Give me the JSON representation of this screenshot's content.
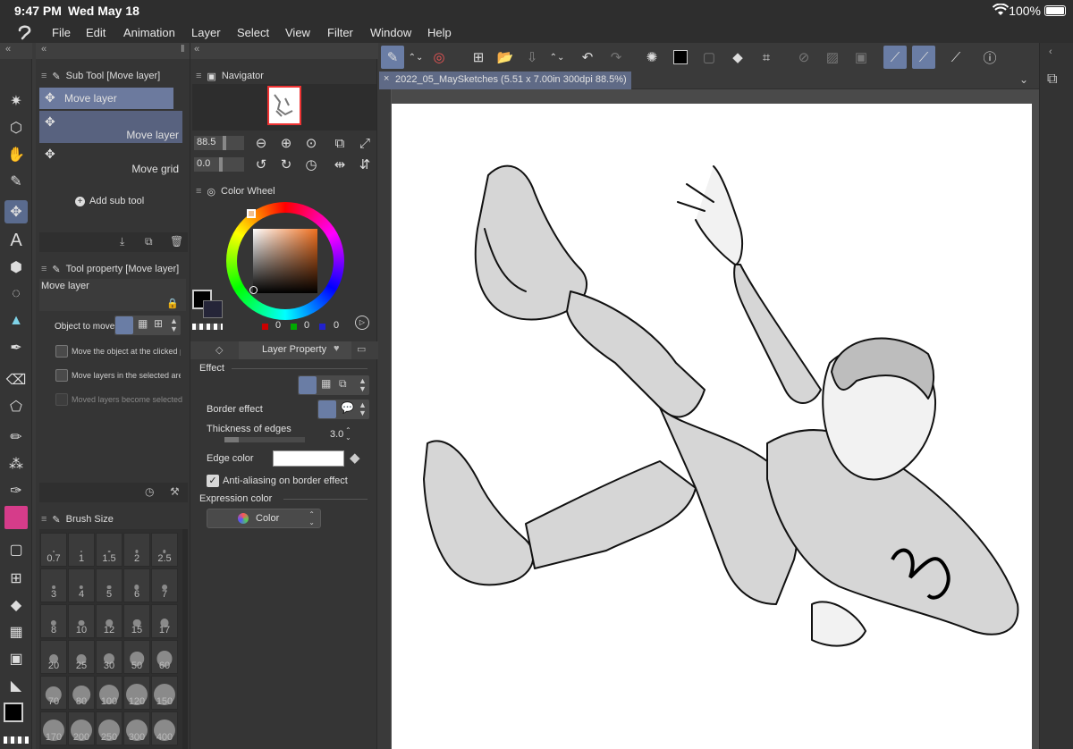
{
  "status": {
    "time": "9:47 PM",
    "date": "Wed May 18",
    "battery": "100%"
  },
  "menu": [
    "File",
    "Edit",
    "Animation",
    "Layer",
    "Select",
    "View",
    "Filter",
    "Window",
    "Help"
  ],
  "subtool": {
    "title": "Sub Tool [Move layer]",
    "header_label": "Move layer",
    "items": [
      "Move layer",
      "Move grid"
    ],
    "add_label": "Add sub tool"
  },
  "tool_property": {
    "title": "Tool property [Move layer]",
    "name": "Move layer",
    "object_to_move": "Object to move",
    "options": [
      "Move the object at the clicked position",
      "Move layers in the selected area",
      "Moved layers become selected"
    ]
  },
  "brush_size": {
    "title": "Brush Size",
    "sizes": [
      "0.7",
      "1",
      "1.5",
      "2",
      "2.5",
      "3",
      "4",
      "5",
      "6",
      "7",
      "8",
      "10",
      "12",
      "15",
      "17",
      "20",
      "25",
      "30",
      "50",
      "60",
      "70",
      "80",
      "100",
      "120",
      "150",
      "170",
      "200",
      "250",
      "300",
      "400"
    ]
  },
  "navigator": {
    "title": "Navigator",
    "zoom": "88.5",
    "rotate": "0.0"
  },
  "color_wheel": {
    "title": "Color Wheel",
    "r": "0",
    "g": "0",
    "b": "0"
  },
  "layer_property": {
    "title": "Layer Property",
    "effect": "Effect",
    "border_effect": "Border effect",
    "thickness_label": "Thickness of edges",
    "thickness_value": "3.0",
    "edge_color": "Edge color",
    "antialias": "Anti-aliasing on border effect",
    "expression_color_label": "Expression color",
    "expression_color_value": "Color"
  },
  "canvas": {
    "tab": "2022_05_MaySketches (5.51 x 7.00in 300dpi 88.5%)"
  },
  "colors": {
    "accent": "#6a7da5",
    "ui_bg": "#353535",
    "hue_marker": "#f0c090"
  }
}
